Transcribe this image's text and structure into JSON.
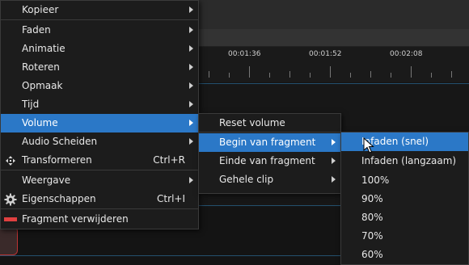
{
  "ruler": {
    "times": [
      "00:01:36",
      "00:01:52",
      "00:02:08"
    ]
  },
  "main_menu": {
    "items": [
      {
        "label": "Kopieer",
        "submenu": true
      },
      {
        "label": "Faden",
        "submenu": true
      },
      {
        "label": "Animatie",
        "submenu": true
      },
      {
        "label": "Roteren",
        "submenu": true
      },
      {
        "label": "Opmaak",
        "submenu": true
      },
      {
        "label": "Tijd",
        "submenu": true
      },
      {
        "label": "Volume",
        "submenu": true,
        "highlighted": true
      },
      {
        "label": "Audio Scheiden",
        "submenu": true
      },
      {
        "label": "Transformeren",
        "shortcut": "Ctrl+R",
        "icon": "move-icon"
      },
      {
        "label": "Weergave",
        "submenu": true
      },
      {
        "label": "Eigenschappen",
        "shortcut": "Ctrl+I",
        "icon": "gear-icon"
      },
      {
        "label": "Fragment verwijderen",
        "icon": "remove-icon"
      }
    ]
  },
  "volume_menu": {
    "items": [
      {
        "label": "Reset volume"
      },
      {
        "label": "Begin van fragment",
        "submenu": true,
        "highlighted": true
      },
      {
        "label": "Einde van fragment",
        "submenu": true
      },
      {
        "label": "Gehele clip",
        "submenu": true
      }
    ]
  },
  "begin_menu": {
    "items": [
      {
        "label": "Infaden (snel)",
        "highlighted": true
      },
      {
        "label": "Infaden (langzaam)"
      },
      {
        "label": "100%"
      },
      {
        "label": "90%"
      },
      {
        "label": "80%"
      },
      {
        "label": "70%"
      },
      {
        "label": "60%"
      }
    ]
  },
  "colors": {
    "highlight": "#2b78c7",
    "menu_bg": "#1c1c1c",
    "remove_icon": "#e04040"
  }
}
